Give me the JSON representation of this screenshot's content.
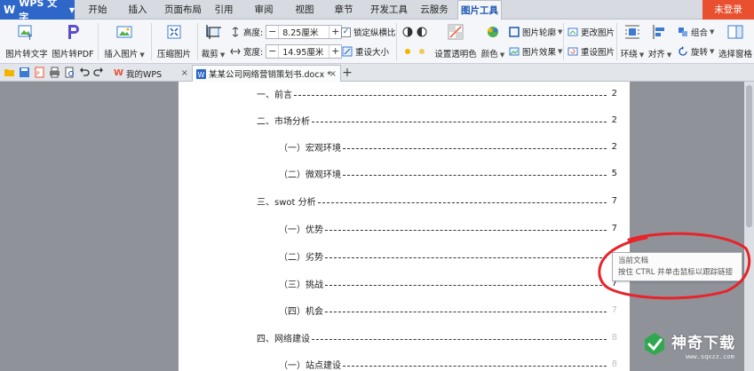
{
  "app": {
    "name": "WPS 文字",
    "logo": "W",
    "login_label": "未登录"
  },
  "menu_tabs": [
    {
      "label": "开始"
    },
    {
      "label": "插入"
    },
    {
      "label": "页面布局"
    },
    {
      "label": "引用"
    },
    {
      "label": "审阅"
    },
    {
      "label": "视图"
    },
    {
      "label": "章节"
    },
    {
      "label": "开发工具"
    },
    {
      "label": "云服务"
    },
    {
      "label": "图片工具",
      "active": true
    }
  ],
  "ribbon": {
    "pic_to_text": "图片转文字",
    "pic_to_pdf": "图片转PDF",
    "insert_picture": "插入图片",
    "compress_picture": "压缩图片",
    "crop": "裁剪",
    "height_label": "高度:",
    "height_value": "8.25厘米",
    "width_label": "宽度:",
    "width_value": "14.95厘米",
    "lock_ratio": "锁定纵横比",
    "reset_size": "重设大小",
    "set_transparent": "设置透明色",
    "color": "颜色",
    "picture_outline": "图片轮廓",
    "picture_effect": "图片效果",
    "change_picture": "更改图片",
    "reset_picture": "重设图片",
    "wrap": "环绕",
    "align": "对齐",
    "group": "组合",
    "rotate": "旋转",
    "selection_pane": "选择窗格"
  },
  "tabs": {
    "home_tab": "我的WPS",
    "file_tab": "某某公司网络营销策划书.docx *"
  },
  "toc": [
    {
      "text": "一、前言",
      "page": "2",
      "level": 1
    },
    {
      "text": "二、市场分析",
      "page": "2",
      "level": 1
    },
    {
      "text": "（一）宏观环境",
      "page": "2",
      "level": 2
    },
    {
      "text": "（二）微观环境",
      "page": "5",
      "level": 2
    },
    {
      "text": "三、swot 分析",
      "page": "7",
      "level": 1
    },
    {
      "text": "（一）优势",
      "page": "7",
      "level": 2
    },
    {
      "text": "（二）劣势",
      "page": "7",
      "level": 2
    },
    {
      "text": "（三）挑战",
      "page": "7",
      "level": 2
    },
    {
      "text": "（四）机会",
      "page": "7",
      "level": 2,
      "faded": true
    },
    {
      "text": "四、网络建设",
      "page": "8",
      "level": 1,
      "faded": true
    },
    {
      "text": "（一）站点建设",
      "page": "8",
      "level": 2,
      "faded": true
    }
  ],
  "tooltip": {
    "line1": "当前文档",
    "line2": "按住 CTRL 并单击鼠标以跟踪链接"
  },
  "watermark": {
    "text": "神奇下载",
    "url": "www.sqxzz.com"
  },
  "colors": {
    "accent": "#2e67c8",
    "login": "#e9502f",
    "annotation": "#e8232a"
  }
}
